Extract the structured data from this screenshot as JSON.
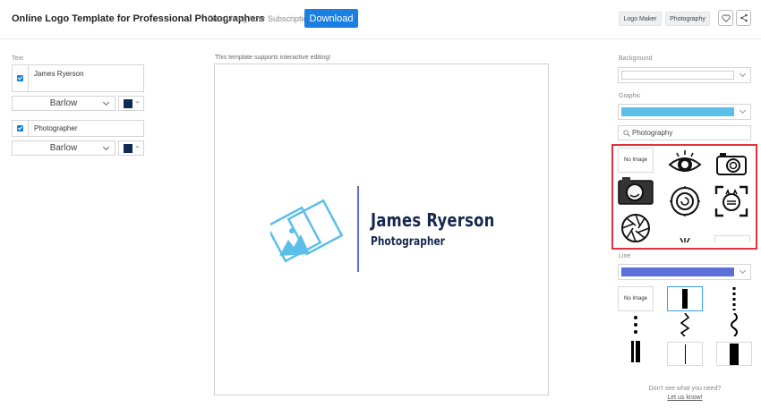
{
  "header": {
    "title": "Online Logo Template for Professional Photographers",
    "subtitle": "Free Using Your Subscription!",
    "download_label": "Download",
    "tags": [
      "Logo Maker",
      "Photography"
    ]
  },
  "left_panel": {
    "section_label": "Text",
    "text_items": [
      {
        "value": "James Ryerson",
        "checked": true,
        "font": "Barlow",
        "color": "#0f2a55"
      },
      {
        "value": "Photographer",
        "checked": true,
        "font": "Barlow",
        "color": "#0f2a55"
      }
    ]
  },
  "canvas": {
    "notice": "This template supports interactive editing!",
    "logo_name": "James Ryerson",
    "logo_tagline": "Photographer",
    "divider_color": "#5b6fd6",
    "icon_color": "#5bbfea",
    "text_color": "#16284f"
  },
  "right_panel": {
    "background_label": "Background",
    "background_color": "#ffffff",
    "graphic_label": "Graphic",
    "graphic_color": "#5bbfea",
    "search_value": "Photography",
    "graphic_no_image": "No Image",
    "graphic_icons": [
      "eye-aperture-icon",
      "camera-icon",
      "camera-filled-icon",
      "lens-icon",
      "face-focus-icon",
      "aperture-icon"
    ],
    "line_label": "Line",
    "line_color": "#5b6fd6",
    "line_no_image": "No Image",
    "line_styles": [
      "solid-bar",
      "dotted-line",
      "dots",
      "zigzag",
      "wavy",
      "double-bar",
      "thin-line",
      "thick-bar"
    ],
    "help_text": "Don't see what you need?",
    "help_link": "Let us know!"
  },
  "colors": {
    "accent": "#1a7fe0",
    "highlight": "#e0323c"
  }
}
